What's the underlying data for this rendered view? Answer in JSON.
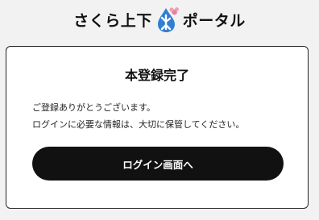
{
  "header": {
    "logo_left": "さくら上下",
    "logo_right": "ポータル",
    "logo_icon": "water-drop-sakura-logo-icon",
    "colors": {
      "logo_blue": "#2f7fd3",
      "logo_pink": "#e7829a"
    }
  },
  "card": {
    "title": "本登録完了",
    "message_line1": "ご登録ありがとうございます。",
    "message_line2": "ログインに必要な情報は、大切に保管してください。",
    "button_label": "ログイン画面へ"
  },
  "colors": {
    "background": "#f2f2f2",
    "card_background": "#ffffff",
    "button_background": "#111111",
    "button_text": "#ffffff"
  }
}
